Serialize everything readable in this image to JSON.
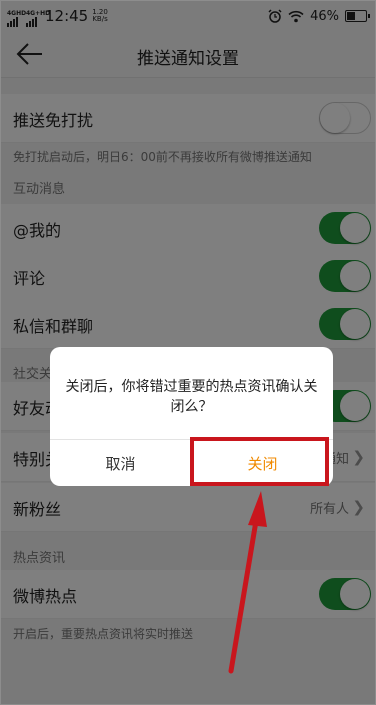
{
  "status_bar": {
    "sim1": "4GHD",
    "sim2": "4G+HD",
    "time": "12:45",
    "net_speed_value": "1.20",
    "net_speed_unit": "KB/s",
    "battery_percent": "46%"
  },
  "header": {
    "title": "推送通知设置"
  },
  "settings": {
    "dnd": {
      "label": "推送免打扰",
      "enabled": false
    },
    "dnd_note": "免打扰启动后，明日6：00前不再接收所有微博推送通知",
    "interaction_section": "互动消息",
    "mentions": {
      "label": "@我的",
      "enabled": true
    },
    "comments": {
      "label": "评论",
      "enabled": true
    },
    "messages": {
      "label": "私信和群聊",
      "enabled": true
    },
    "social_section": "社交关系",
    "friends": {
      "label": "好友动态",
      "enabled": true
    },
    "special": {
      "label": "特别关注",
      "value": "通知"
    },
    "new_fans": {
      "label": "新粉丝",
      "value": "所有人"
    },
    "hot_section": "热点资讯",
    "weibo_hot": {
      "label": "微博热点",
      "enabled": true
    },
    "hot_note": "开启后，重要热点资讯将实时推送"
  },
  "dialog": {
    "message": "关闭后，你将错过重要的热点资讯确认关闭么？",
    "cancel_label": "取消",
    "confirm_label": "关闭"
  },
  "colors": {
    "toggle_on": "#1f9a3a",
    "confirm_text": "#f08a00",
    "highlight_border": "#c9161d"
  }
}
